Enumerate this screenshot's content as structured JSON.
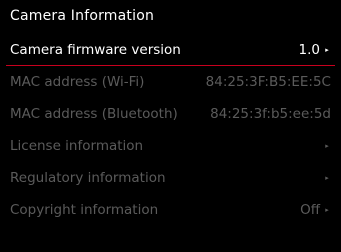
{
  "header": {
    "title": "Camera Information"
  },
  "menu": {
    "items": [
      {
        "label": "Camera firmware version",
        "value": "1.0",
        "arrow": "▸"
      },
      {
        "label": "MAC address (Wi-Fi)",
        "value": "84:25:3F:B5:EE:5C"
      },
      {
        "label": "MAC address (Bluetooth)",
        "value": "84:25:3f:b5:ee:5d"
      },
      {
        "label": "License information",
        "arrow": "▸"
      },
      {
        "label": "Regulatory information",
        "arrow": "▸"
      },
      {
        "label": "Copyright information",
        "value": "Off",
        "arrow": "▸"
      }
    ]
  },
  "colors": {
    "background": "#000000",
    "accent": "#c8001e",
    "dim_text": "#5b5b5b",
    "active_text": "#ffffff"
  }
}
